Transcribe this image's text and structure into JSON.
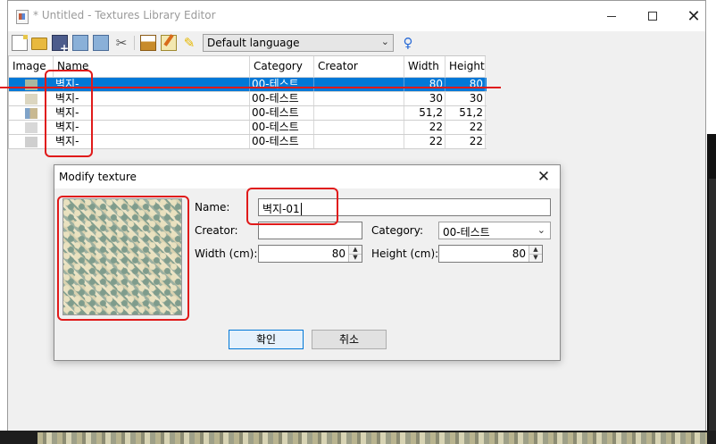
{
  "window": {
    "title": "* Untitled - Textures Library Editor",
    "controls": {
      "minimize": "minimize",
      "maximize": "maximize",
      "close": "✕"
    }
  },
  "toolbar": {
    "language_select": {
      "value": "Default language"
    },
    "icons": [
      "new-icon",
      "open-icon",
      "add-texture-icon",
      "import-icon",
      "export-icon",
      "tools-icon",
      "download-icon",
      "modify-icon",
      "clean-icon",
      "help-icon"
    ]
  },
  "table": {
    "columns": [
      "Image",
      "Name",
      "Category",
      "Creator",
      "Width",
      "Height"
    ],
    "rows": [
      {
        "name": "벽지-",
        "category": "00-테스트",
        "creator": "",
        "width": "80",
        "height": "80",
        "selected": true
      },
      {
        "name": "벽지-",
        "category": "00-테스트",
        "creator": "",
        "width": "30",
        "height": "30",
        "selected": false
      },
      {
        "name": "벽지-",
        "category": "00-테스트",
        "creator": "",
        "width": "51,2",
        "height": "51,2",
        "selected": false
      },
      {
        "name": "벽지-",
        "category": "00-테스트",
        "creator": "",
        "width": "22",
        "height": "22",
        "selected": false
      },
      {
        "name": "벽지-",
        "category": "00-테스트",
        "creator": "",
        "width": "22",
        "height": "22",
        "selected": false
      }
    ]
  },
  "dialog": {
    "title": "Modify texture",
    "close": "✕",
    "name_label": "Name:",
    "name_value": "벽지-01",
    "creator_label": "Creator:",
    "creator_value": "",
    "category_label": "Category:",
    "category_value": "00-테스트",
    "width_label": "Width (cm):",
    "width_value": "80",
    "height_label": "Height (cm):",
    "height_value": "80",
    "ok_button": "확인",
    "cancel_button": "취소"
  },
  "colors": {
    "selection": "#0078d7",
    "annotation_red": "#e01a1a",
    "title_text": "#9a9a9a"
  }
}
